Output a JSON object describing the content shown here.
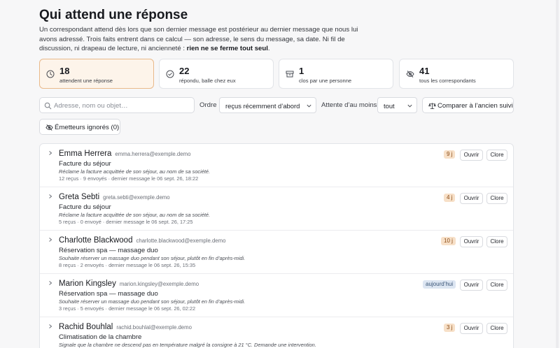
{
  "header": {
    "title": "Qui attend une réponse",
    "intro": "Un correspondant attend dès lors que son dernier message est postérieur au dernier message que nous lui avons adressé. Trois faits entrent dans ce calcul — son adresse, le sens du message, sa date. Ni fil de discussion, ni drapeau de lecture, ni ancienneté : ",
    "intro_bold": "rien ne se ferme tout seul",
    "intro_end": "."
  },
  "stats": [
    {
      "value": "18",
      "label": "attendent une réponse",
      "icon": "clock-icon",
      "active": true
    },
    {
      "value": "22",
      "label": "répondu, balle chez eux",
      "icon": "check-circle-icon",
      "active": false
    },
    {
      "value": "1",
      "label": "clos par une personne",
      "icon": "archive-icon",
      "active": false
    },
    {
      "value": "41",
      "label": "tous les correspondants",
      "icon": "eye-off-icon",
      "active": false
    }
  ],
  "filters": {
    "search_placeholder": "Adresse, nom ou objet…",
    "order_label": "Ordre",
    "order_value": "reçus récemment d’abord",
    "wait_label": "Attente d’au moins",
    "wait_value": "tout",
    "compare_label": "Comparer à l’ancien suivi",
    "ignored_label": "Émetteurs ignorés (0)"
  },
  "actions": {
    "open": "Ouvrir",
    "close": "Clore"
  },
  "rows": [
    {
      "name": "Emma Herrera",
      "email": "emma.herrera@exemple.demo",
      "subject": "Facture du séjour",
      "summary": "Réclame la facture acquittée de son séjour, au nom de sa société.",
      "meta": "12 reçus · 9 envoyés · dernier message le 06 sept. 26, 18:22",
      "badge": "9 j",
      "badge_type": "days"
    },
    {
      "name": "Greta Sebti",
      "email": "greta.sebti@exemple.demo",
      "subject": "Facture du séjour",
      "summary": "Réclame la facture acquittée de son séjour, au nom de sa société.",
      "meta": "5 reçus · 0 envoyé · dernier message le 06 sept. 26, 17:25",
      "badge": "4 j",
      "badge_type": "days"
    },
    {
      "name": "Charlotte Blackwood",
      "email": "charlotte.blackwood@exemple.demo",
      "subject": "Réservation spa — massage duo",
      "summary": "Souhaite réserver un massage duo pendant son séjour, plutôt en fin d’après-midi.",
      "meta": "8 reçus · 2 envoyés · dernier message le 06 sept. 26, 15:35",
      "badge": "10 j",
      "badge_type": "days"
    },
    {
      "name": "Marion Kingsley",
      "email": "marion.kingsley@exemple.demo",
      "subject": "Réservation spa — massage duo",
      "summary": "Souhaite réserver un massage duo pendant son séjour, plutôt en fin d’après-midi.",
      "meta": "3 reçus · 5 envoyés · dernier message le 06 sept. 26, 02:22",
      "badge": "aujourd’hui",
      "badge_type": "today"
    },
    {
      "name": "Rachid Bouhlal",
      "email": "rachid.bouhlal@exemple.demo",
      "subject": "Climatisation de la chambre",
      "summary": "Signale que la chambre ne descend pas en température malgré la consigne à 21 °C. Demande une intervention.",
      "meta": "",
      "badge": "3 j",
      "badge_type": "days"
    }
  ]
}
